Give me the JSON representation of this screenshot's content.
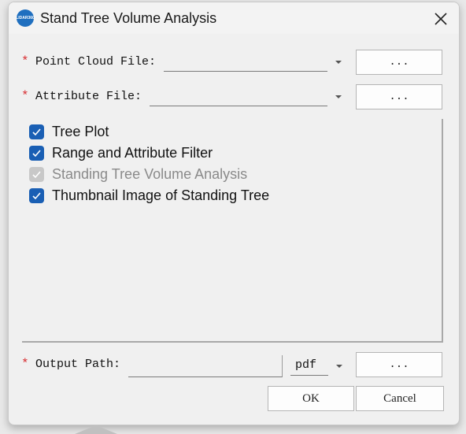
{
  "window": {
    "title": "Stand Tree Volume Analysis",
    "logo_text": "LIDAR360"
  },
  "fields": {
    "required_mark": "*",
    "point_cloud": {
      "label": "Point Cloud File:",
      "value": "",
      "browse_label": "..."
    },
    "attribute": {
      "label": "Attribute File:",
      "value": "",
      "browse_label": "..."
    },
    "output_path": {
      "label": "Output Path:",
      "value": "",
      "format": "pdf",
      "browse_label": "..."
    }
  },
  "options": [
    {
      "label": "Tree Plot",
      "checked": true,
      "enabled": true
    },
    {
      "label": "Range and Attribute Filter",
      "checked": true,
      "enabled": true
    },
    {
      "label": "Standing Tree Volume Analysis",
      "checked": true,
      "enabled": false
    },
    {
      "label": "Thumbnail Image of Standing Tree",
      "checked": true,
      "enabled": true
    }
  ],
  "buttons": {
    "ok": "OK",
    "cancel": "Cancel"
  },
  "colors": {
    "accent": "#1a5fb4",
    "required": "#d7292d",
    "disabled": "#c8c8c8"
  }
}
